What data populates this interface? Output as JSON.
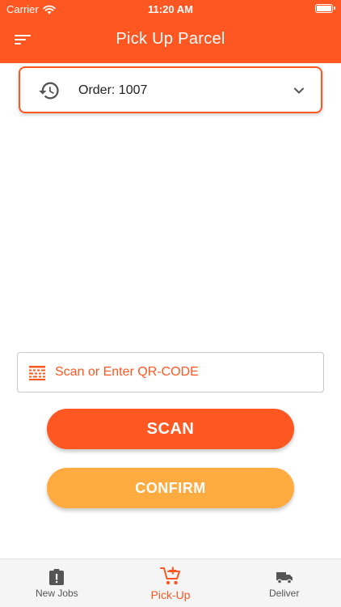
{
  "status_bar": {
    "carrier": "Carrier",
    "time": "11:20 AM"
  },
  "header": {
    "title": "Pick Up Parcel",
    "menu_icon": "menu-icon"
  },
  "order_select": {
    "label": "Order: 1007",
    "icon": "history-icon",
    "dropdown_icon": "chevron-down-icon"
  },
  "qr_input": {
    "placeholder": "Scan or Enter QR-CODE",
    "value": "",
    "icon": "barcode-icon"
  },
  "buttons": {
    "scan": "SCAN",
    "confirm": "CONFIRM"
  },
  "bottom_nav": {
    "items": [
      {
        "label": "New Jobs",
        "icon": "clipboard-alert-icon",
        "active": false
      },
      {
        "label": "Pick-Up",
        "icon": "cart-plus-icon",
        "active": true
      },
      {
        "label": "Deliver",
        "icon": "truck-icon",
        "active": false
      }
    ]
  },
  "colors": {
    "primary": "#ff5722",
    "secondary": "#ffab40",
    "nav_inactive": "#555555"
  }
}
